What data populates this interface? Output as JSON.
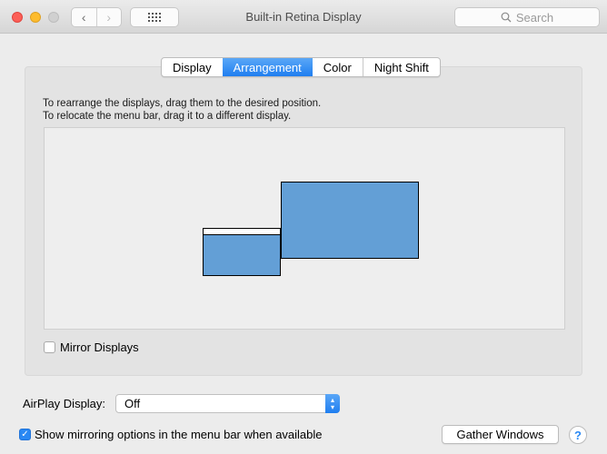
{
  "window": {
    "title": "Built-in Retina Display",
    "search_placeholder": "Search",
    "nav": {
      "back_icon": "‹",
      "forward_icon": "›"
    }
  },
  "tabs": [
    {
      "label": "Display",
      "active": false
    },
    {
      "label": "Arrangement",
      "active": true
    },
    {
      "label": "Color",
      "active": false
    },
    {
      "label": "Night Shift",
      "active": false
    }
  ],
  "arrangement": {
    "instruction_line1": "To rearrange the displays, drag them to the desired position.",
    "instruction_line2": "To relocate the menu bar, drag it to a different display.",
    "display_color": "#639fd6",
    "displays": [
      {
        "name": "built-in-display",
        "has_menu_bar": true
      },
      {
        "name": "external-display",
        "has_menu_bar": false
      }
    ],
    "mirror_displays_label": "Mirror Displays",
    "mirror_displays_checked": false
  },
  "airplay": {
    "label": "AirPlay Display:",
    "value": "Off"
  },
  "show_mirroring": {
    "label": "Show mirroring options in the menu bar when available",
    "checked": true
  },
  "buttons": {
    "gather_windows": "Gather Windows",
    "help": "?"
  },
  "colors": {
    "accent": "#2a88f3",
    "tab_active": "#1f7ef0"
  }
}
